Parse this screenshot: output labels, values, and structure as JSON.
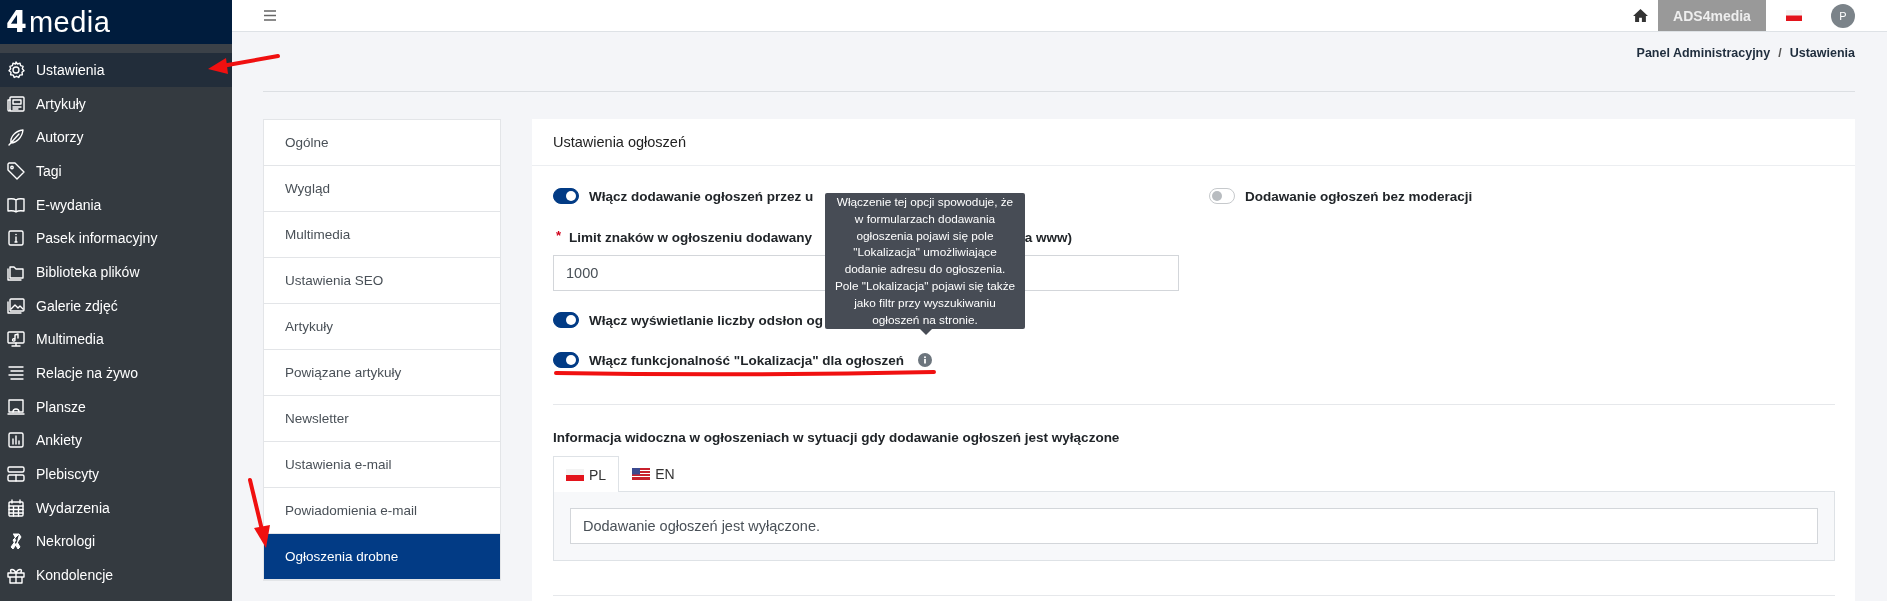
{
  "logo": {
    "mark": "4",
    "name": "media"
  },
  "sidebar": {
    "items": [
      {
        "label": "Ustawienia",
        "selected": true
      },
      {
        "label": "Artykuły",
        "selected": false
      },
      {
        "label": "Autorzy",
        "selected": false
      },
      {
        "label": "Tagi",
        "selected": false
      },
      {
        "label": "E-wydania",
        "selected": false
      },
      {
        "label": "Pasek informacyjny",
        "selected": false
      },
      {
        "label": "Biblioteka plików",
        "selected": false
      },
      {
        "label": "Galerie zdjęć",
        "selected": false
      },
      {
        "label": "Multimedia",
        "selected": false
      },
      {
        "label": "Relacje na żywo",
        "selected": false
      },
      {
        "label": "Plansze",
        "selected": false
      },
      {
        "label": "Ankiety",
        "selected": false
      },
      {
        "label": "Plebiscyty",
        "selected": false
      },
      {
        "label": "Wydarzenia",
        "selected": false
      },
      {
        "label": "Nekrologi",
        "selected": false
      },
      {
        "label": "Kondolencje",
        "selected": false
      }
    ]
  },
  "topbar": {
    "account_button": "ADS4media",
    "avatar": "P"
  },
  "breadcrumb": {
    "items": [
      "Panel Administracyjny",
      "Ustawienia"
    ],
    "separator": "/"
  },
  "settings_menu": [
    {
      "label": "Ogólne",
      "selected": false
    },
    {
      "label": "Wygląd",
      "selected": false
    },
    {
      "label": "Multimedia",
      "selected": false
    },
    {
      "label": "Ustawienia SEO",
      "selected": false
    },
    {
      "label": "Artykuły",
      "selected": false
    },
    {
      "label": "Powiązane artykuły",
      "selected": false
    },
    {
      "label": "Newsletter",
      "selected": false
    },
    {
      "label": "Ustawienia e-mail",
      "selected": false
    },
    {
      "label": "Powiadomienia e-mail",
      "selected": false
    },
    {
      "label": "Ogłoszenia drobne",
      "selected": true
    }
  ],
  "card": {
    "title": "Ustawienia ogłoszeń",
    "add_toggle": {
      "label": "Włącz dodawanie ogłoszeń przez u",
      "on": true
    },
    "moderation_toggle": {
      "label": "Dodawanie ogłoszeń bez moderacji",
      "on": false
    },
    "limit_field": {
      "required_mark": "*",
      "label_parts": [
        "Limit znaków w ogłoszeniu dodawany",
        "a www)"
      ],
      "value": "1000"
    },
    "views_toggle": {
      "label": "Włącz wyświetlanie liczby odsłon og",
      "on": true
    },
    "location_toggle": {
      "label": "Włącz funkcjonalność \"Lokalizacja\" dla ogłoszeń",
      "on": true
    },
    "tooltip": "Włączenie tej opcji spowoduje, że w formularzach dodawania ogłoszenia pojawi się pole \"Lokalizacja\" umożliwiające dodanie adresu do ogłoszenia. Pole \"Lokalizacja\" pojawi się także jako filtr przy wyszukiwaniu ogłoszeń na stronie.",
    "disabled_info": {
      "heading": "Informacja widoczna w ogłoszeniach w sytuacji gdy dodawanie ogłoszeń jest wyłączone",
      "tabs": [
        {
          "label": "PL",
          "selected": true
        },
        {
          "label": "EN",
          "selected": false
        }
      ],
      "value": "Dodawanie ogłoszeń jest wyłączone."
    }
  }
}
